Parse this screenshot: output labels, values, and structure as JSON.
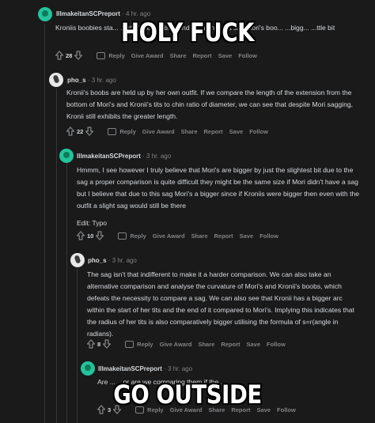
{
  "comments": [
    {
      "user": "IllmakeitanSCPreport",
      "time": "4 hr. ago",
      "body": [
        "Kroniis boobies sta... ...nt of the boobies and including that sag Mori's boo... ...bigg... ...ttle bit"
      ],
      "score": "28",
      "actions": {
        "reply": "Reply",
        "award": "Give Award",
        "share": "Share",
        "report": "Report",
        "save": "Save",
        "follow": "Follow"
      }
    },
    {
      "user": "pho_s",
      "time": "3 hr. ago",
      "body": [
        "Kronii's boobs are held up by her own outfit. If we compare the length of the extension from the bottom of Mori's and Kronii's tits to chin ratio of diameter, we can see that despite Mori sagging, Kronii still exhibits the greater length."
      ],
      "score": "22",
      "actions": {
        "reply": "Reply",
        "award": "Give Award",
        "share": "Share",
        "report": "Report",
        "save": "Save",
        "follow": "Follow"
      }
    },
    {
      "user": "IllmakeitanSCPreport",
      "time": "3 hr. ago",
      "body": [
        "Hmmm, I see however I truly believe that Mori's are bigger by just the slightest bit due to the sag a proper comparison is quite difficult they might be the same size if Mori didn't have a sag but I believe that due to this sag Mori's a bigger since if Kroniis were bigger then even with the outfit a slight sag would still be there",
        "Edit: Typo"
      ],
      "score": "10",
      "actions": {
        "reply": "Reply",
        "award": "Give Award",
        "share": "Share",
        "report": "Report",
        "save": "Save",
        "follow": "Follow"
      }
    },
    {
      "user": "pho_s",
      "time": "3 hr. ago",
      "body": [
        "The sag isn't that indifferent to make it a harder comparison. We can also take an alternative comparison and analyse the curvature of Mori's and Kronii's boobs, which defeats the necessity to compare a sag. We can also see that Kronii has a bigger arc within the start of her tits and the end of it compared to Mori's. Implying this indicates that the radius of her tits is also comparatively bigger utilising the formula of s=r(angle in radians)."
      ],
      "score": "8",
      "actions": {
        "reply": "Reply",
        "award": "Give Award",
        "share": "Share",
        "report": "Report",
        "save": "Save",
        "follow": "Follow"
      }
    },
    {
      "user": "IllmakeitanSCPreport",
      "time": "3 hr. ago",
      "body": [
        "Are ... ...or are we comparing them if the..."
      ],
      "score": "3",
      "actions": {
        "reply": "Reply",
        "award": "Give Award",
        "share": "Share",
        "report": "Report",
        "save": "Save",
        "follow": "Follow"
      }
    }
  ],
  "meme": {
    "top": "HOLY FUCK",
    "bottom": "GO OUTSIDE"
  },
  "colors": {
    "background": "#1a1a1b",
    "text": "#d7dadc",
    "muted": "#818384",
    "avatar_green": "#23c49b"
  }
}
